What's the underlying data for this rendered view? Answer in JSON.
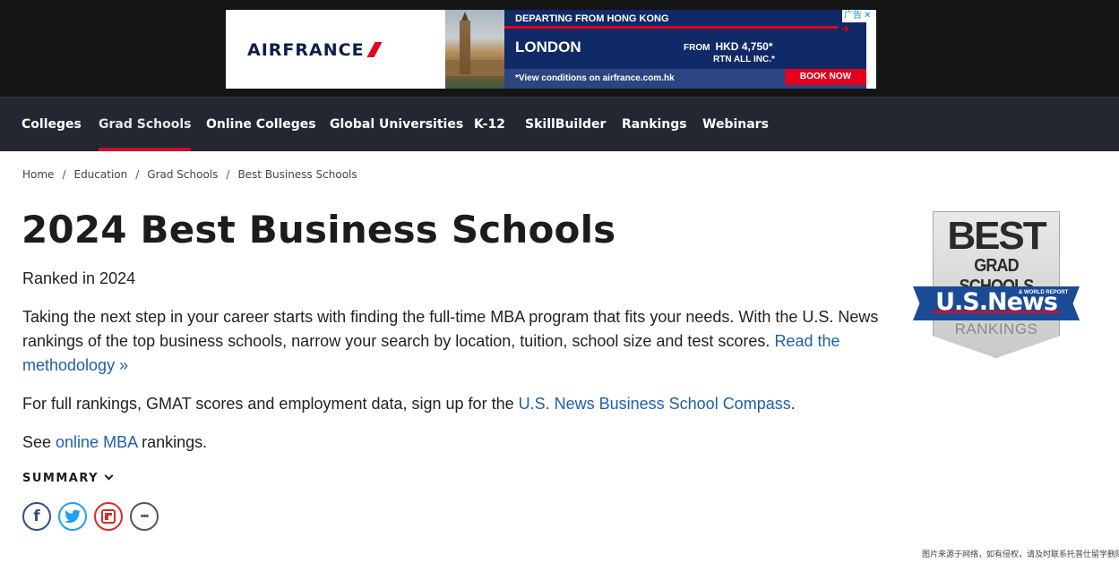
{
  "ad": {
    "logo": "AIRFRANCE",
    "departing": "DEPARTING FROM HONG KONG",
    "city": "LONDON",
    "fare_prefix": "FROM",
    "fare": "HKD 4,750*",
    "rtn": "RTN ALL INC.*",
    "view": "*View conditions on airfrance.com.hk",
    "book": "BOOK NOW",
    "corner": "广告",
    "close": "✕"
  },
  "nav": {
    "items": [
      {
        "label": "Colleges",
        "active": false
      },
      {
        "label": "Grad Schools",
        "active": true
      },
      {
        "label": "Online Colleges",
        "active": false
      },
      {
        "label": "Global Universities",
        "active": false
      },
      {
        "label": "K-12",
        "active": false
      },
      {
        "label": "SkillBuilder",
        "active": false
      },
      {
        "label": "Rankings",
        "active": false
      },
      {
        "label": "Webinars",
        "active": false
      }
    ]
  },
  "breadcrumb": {
    "items": [
      "Home",
      "Education",
      "Grad Schools",
      "Best Business Schools"
    ],
    "separator": "/"
  },
  "page": {
    "title": "2024 Best Business Schools",
    "ranked": "Ranked in 2024",
    "p1_text": "Taking the next step in your career starts with finding the full-time MBA program that fits your needs. With the U.S. News rankings of the top business schools, narrow your search by location, tuition, school size and test scores. ",
    "p1_link": "Read the methodology »",
    "p2_text": "For full rankings, GMAT scores and employment data, sign up for the ",
    "p2_link": "U.S. News Business School Compass",
    "p2_end": ".",
    "p3_start": "See ",
    "p3_link": "online MBA",
    "p3_end": " rankings.",
    "summary": "SUMMARY"
  },
  "share": {
    "facebook": "f",
    "more": "•••"
  },
  "badge": {
    "best": "BEST",
    "grad": "GRAD SCHOOLS",
    "brand": "U.S.News",
    "world_report": "& WORLD REPORT",
    "rankings": "RANKINGS"
  },
  "footnote": "图片来源于网络，如有侵权，请及时联系托普仕留学删除",
  "colors": {
    "nav_bg": "#232731",
    "active_underline": "#c8102e",
    "link": "#1f5faa",
    "ad_blue": "#0f2a66",
    "ad_red": "#e3001b"
  }
}
